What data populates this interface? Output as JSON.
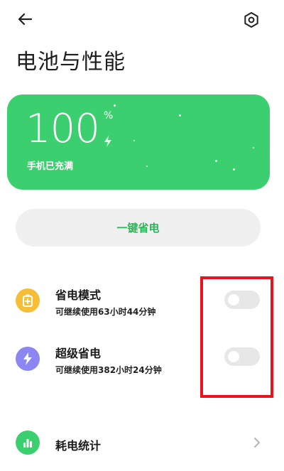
{
  "header": {
    "title": "电池与性能"
  },
  "battery": {
    "percent": "100",
    "percent_sign": "%",
    "status": "手机已充满",
    "card_color": "#3ccf6f"
  },
  "one_key_button": {
    "label": "一键省电",
    "text_color": "#2fb45a"
  },
  "settings": [
    {
      "title": "省电模式",
      "subtitle": "可继续使用63小时44分钟",
      "icon": "battery-saver-icon",
      "icon_color": "#f6bd36",
      "toggle_on": false
    },
    {
      "title": "超级省电",
      "subtitle": "可继续使用382小时24分钟",
      "icon": "lightning-icon",
      "icon_color": "#8b86f2",
      "toggle_on": false
    }
  ],
  "usage_stats": {
    "title": "耗电统计",
    "icon": "bar-chart-icon",
    "icon_color": "#3ccf6f"
  },
  "annotation": {
    "highlight_color": "#e8141b"
  }
}
